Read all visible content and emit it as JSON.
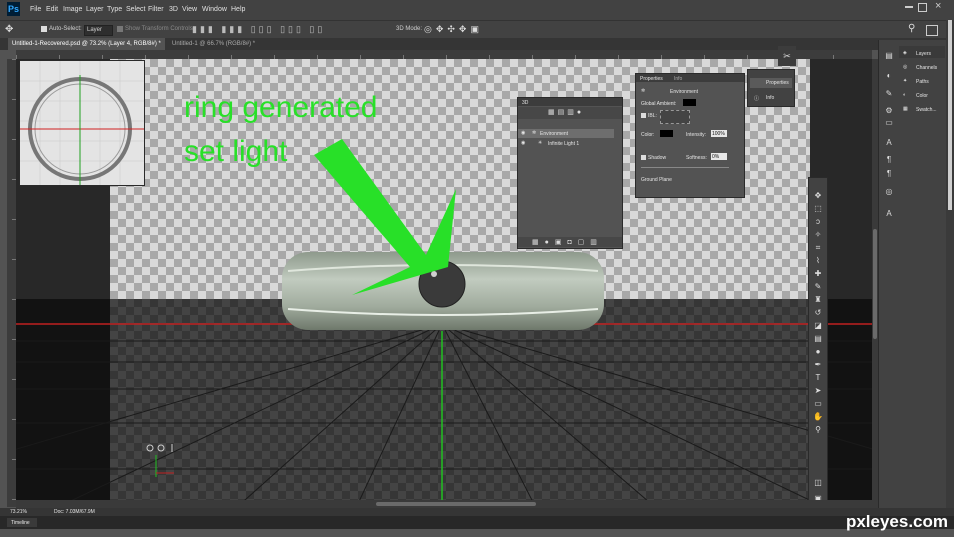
{
  "app": {
    "logo": "Ps"
  },
  "menu": [
    "File",
    "Edit",
    "Image",
    "Layer",
    "Type",
    "Select",
    "Filter",
    "3D",
    "View",
    "Window",
    "Help"
  ],
  "options": {
    "auto_select_label": "Auto-Select:",
    "auto_select_value": "Layer",
    "show_transform_label": "Show Transform Controls",
    "mode_3d_label": "3D Mode:"
  },
  "tabs": [
    {
      "label": "Untitled-1-Recovered.psd @ 73.2% (Layer 4, RGB/8#) *"
    },
    {
      "label": "Untitled-1 @ 66.7% (RGB/8#) *"
    }
  ],
  "close_glyph": "×",
  "annotation": {
    "line1": "ring generated",
    "line2": "set light"
  },
  "panel_3d": {
    "title": "3D",
    "items": [
      "Environment",
      "Infinite Light 1"
    ]
  },
  "properties": {
    "tabs": [
      "Properties",
      "Info"
    ],
    "heading": "Environment",
    "global_ambient_label": "Global Ambient:",
    "ibl_label": "IBL:",
    "color_label": "Color:",
    "intensity_label": "Intensity:",
    "intensity_value": "100%",
    "shadow_label": "Shadow",
    "softness_label": "Softness:",
    "softness_value": "0%",
    "ground_plane_label": "Ground Plane"
  },
  "mini_panel": {
    "items": [
      "Properties",
      "Info"
    ]
  },
  "right_panel": {
    "items": [
      "Layers",
      "Channels",
      "Paths",
      "Color",
      "Swatch..."
    ]
  },
  "status": {
    "zoom": "73.21%",
    "doc": "Doc: 7.03M/67.9M"
  },
  "timeline": {
    "label": "Timeline"
  },
  "watermark": "pxleyes.com",
  "colors": {
    "accent_green": "#28e028",
    "foreground_swatch": "#28e028"
  }
}
